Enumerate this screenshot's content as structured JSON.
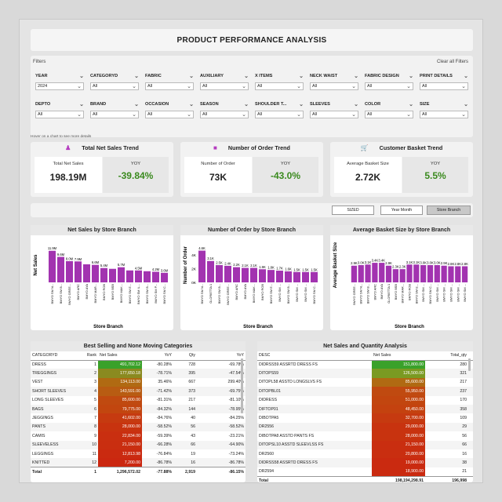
{
  "title": "PRODUCT PERFORMANCE ANALYSIS",
  "filters": {
    "heading": "Filters",
    "clear_label": "Clear all Filters",
    "items": [
      {
        "label": "YEAR",
        "value": "2024"
      },
      {
        "label": "CATEGORYD",
        "value": "All"
      },
      {
        "label": "FABRIC",
        "value": "All"
      },
      {
        "label": "AUXILIARY",
        "value": "All"
      },
      {
        "label": "X ITEMS",
        "value": "All"
      },
      {
        "label": "NECK WAIST",
        "value": "All"
      },
      {
        "label": "FABRIC DESIGN",
        "value": "All"
      },
      {
        "label": "PRINT DETAILS",
        "value": "All"
      },
      {
        "label": "DEPTO",
        "value": "All"
      },
      {
        "label": "BRAND",
        "value": "All"
      },
      {
        "label": "OCCASION",
        "value": "All"
      },
      {
        "label": "SEASON",
        "value": "All"
      },
      {
        "label": "SHOULDER T...",
        "value": "All"
      },
      {
        "label": "SLEEVES",
        "value": "All"
      },
      {
        "label": "COLOR",
        "value": "All"
      },
      {
        "label": "SIZE",
        "value": "All"
      }
    ]
  },
  "hover_hint": "Hover on a chart to see more details",
  "kpis": [
    {
      "title": "Total Net Sales Trend",
      "icon": "person-icon",
      "label": "Total Net Sales",
      "value": "198.19M",
      "yoy_label": "YOY",
      "yoy": "-39.84%"
    },
    {
      "title": "Number of Order Trend",
      "icon": "box-icon",
      "label": "Number of Order",
      "value": "73K",
      "yoy_label": "YOY",
      "yoy": "-43.0%"
    },
    {
      "title": "Customer Basket Trend",
      "icon": "cart-icon",
      "label": "Average Basket Size",
      "value": "2.72K",
      "yoy_label": "YOY",
      "yoy": "5.5%"
    }
  ],
  "toggles": [
    {
      "label": "SIZED",
      "active": false
    },
    {
      "label": "Year Month",
      "active": false
    },
    {
      "label": "Store Branch",
      "active": true
    }
  ],
  "colors": {
    "bar": "#a233b0",
    "line": "#b03cc0",
    "positive": "#3a8a1e"
  },
  "chart_data": [
    {
      "type": "bar",
      "title": "Net Sales by Store Branch",
      "xlabel": "Store Branch",
      "ylabel": "Net Sales",
      "categories": [
        "BMYO SM N...",
        "BMYO SM B...",
        "BMYO GREE...",
        "BMYO ARC",
        "BMYO AYA",
        "BMYO MAR...",
        "BMYO ROB",
        "BMYO BSB",
        "BMYO MAK...",
        "BMYO SM E...",
        "BMYO SM IL...",
        "BMYO SM B...",
        "BMYO SM P...",
        "BMYO SM C..."
      ],
      "values": [
        11.9,
        9.6,
        8.0,
        7.9,
        6.8,
        6.6,
        5.4,
        5.1,
        5.7,
        4.5,
        4.5,
        4.2,
        4.0,
        3.6
      ],
      "data_labels": [
        "11.9M",
        "9.6M",
        "8.0M",
        "7.9M",
        "",
        "6.6M",
        "5.4M",
        "",
        "5.7M",
        "",
        "4.5M",
        "",
        "4.2M",
        "3.6M"
      ],
      "ylim": [
        0,
        13
      ]
    },
    {
      "type": "bar",
      "title": "Number of Order by Store Branch",
      "xlabel": "Store Branch",
      "ylabel": "Number of Order",
      "categories": [
        "BMYO SM N...",
        "GLORIETTA 1",
        "BMYO SM B...",
        "BMYO GREE...",
        "BMYO ARC",
        "BMYO AYA",
        "BMYO MAK...",
        "BMYO ROB",
        "BMYO SM E...",
        "BMYO SM ...",
        "BMYO SM B...",
        "BMYO SM ...",
        "BMYO SM ...",
        "BMYO SM C..."
      ],
      "values": [
        4.6,
        3.1,
        2.5,
        2.4,
        2.2,
        2.1,
        2.1,
        1.9,
        1.8,
        1.7,
        1.6,
        1.5,
        1.5,
        1.5
      ],
      "data_labels": [
        "4.6K",
        "3.1K",
        "2.5K",
        "2.4K",
        "2.2K",
        "2.1K",
        "2.1K",
        "1.9K",
        "1.8K",
        "1.7K",
        "1.6K",
        "1.5K",
        "1.5K",
        "1.5K"
      ],
      "yticks": [
        "0K",
        "2K",
        "4K"
      ],
      "ylim": [
        0,
        5
      ]
    },
    {
      "type": "bar",
      "title": "Average Basket Size by Store Branch",
      "xlabel": "Store Branch",
      "ylabel": "Average Basket Size",
      "categories": [
        "BMYO GREE...",
        "BMYO SM N...",
        "BMYO SM B...",
        "BMYO ARC",
        "BMYO AYA",
        "GLORIETTA 1",
        "BMYO BSB",
        "BMYO MAR...",
        "BMYO ROB",
        "BMYO SM E...",
        "BMYO SM ...",
        "BMYO SM C...",
        "BMYO SM ...",
        "BMYO SM ...",
        "BMYO SM ...",
        "BMYO SM ...",
        "BMYO SM ..."
      ],
      "values": [
        2.9,
        3.0,
        3.1,
        3.4,
        3.4,
        2.9,
        2.3,
        2.3,
        3.1,
        3.1,
        3.0,
        3.0,
        3.0,
        2.9,
        2.8,
        2.8,
        2.8
      ],
      "data_labels": [
        "2.9K",
        "3.0K",
        "3.1K",
        "3.4K",
        "3.4K",
        "2.9K",
        "2.3K",
        "2.3K",
        "3.1K",
        "3.1K",
        "3.0K",
        "3.0K",
        "3.0K",
        "2.9K",
        "2.8K",
        "2.8K",
        "2.8K"
      ],
      "ylim": [
        0,
        6
      ]
    }
  ],
  "best_selling": {
    "title": "Best Selling and None Moving Categories",
    "headers": [
      "CATEGORYD",
      "Rank",
      "Net Sales",
      "YoY",
      "Qty",
      "YoY"
    ],
    "rows": [
      {
        "cat": "DRESS",
        "rank": "1",
        "sales": "491,702.12",
        "yoy": "-80.28%",
        "qty": "728",
        "qyoy": "-69.78%",
        "bg": "#3aa12a"
      },
      {
        "cat": "TREGGINGS",
        "rank": "2",
        "sales": "177,650.18",
        "yoy": "-78.71%",
        "qty": "395",
        "qyoy": "-47.54%",
        "bg": "#8a8a20"
      },
      {
        "cat": "VEST",
        "rank": "3",
        "sales": "134,113.00",
        "yoy": "35.46%",
        "qty": "667",
        "qyoy": "299.40%",
        "bg": "#b06a12"
      },
      {
        "cat": "SHORT SLEEVES",
        "rank": "4",
        "sales": "143,591.00",
        "yoy": "-71.42%",
        "qty": "373",
        "qyoy": "-69.75%",
        "bg": "#b85c12"
      },
      {
        "cat": "LONG SLEEVES",
        "rank": "5",
        "sales": "85,600.00",
        "yoy": "-81.31%",
        "qty": "217",
        "qyoy": "-81.10%",
        "bg": "#c04a10"
      },
      {
        "cat": "BAGS",
        "rank": "6",
        "sales": "79,775.00",
        "yoy": "-84.32%",
        "qty": "144",
        "qyoy": "-78.95%",
        "bg": "#c2460f"
      },
      {
        "cat": "JEGGINGS",
        "rank": "7",
        "sales": "41,602.00",
        "yoy": "-84.76%",
        "qty": "40",
        "qyoy": "-84.25%",
        "bg": "#c63a10"
      },
      {
        "cat": "PANTS",
        "rank": "8",
        "sales": "28,000.00",
        "yoy": "-58.52%",
        "qty": "56",
        "qyoy": "-58.52%",
        "bg": "#c8330f"
      },
      {
        "cat": "CAMIS",
        "rank": "9",
        "sales": "22,834.00",
        "yoy": "-59.39%",
        "qty": "43",
        "qyoy": "-23.21%",
        "bg": "#c92f10"
      },
      {
        "cat": "SLEEVELESS",
        "rank": "10",
        "sales": "21,150.00",
        "yoy": "-66.28%",
        "qty": "66",
        "qyoy": "-64.90%",
        "bg": "#c92e10"
      },
      {
        "cat": "LEGGINGS",
        "rank": "11",
        "sales": "12,813.98",
        "yoy": "-76.84%",
        "qty": "19",
        "qyoy": "-73.24%",
        "bg": "#ca2a10"
      },
      {
        "cat": "KNITTED",
        "rank": "12",
        "sales": "7,200.00",
        "yoy": "-86.78%",
        "qty": "16",
        "qyoy": "-86.78%",
        "bg": "#cb2710"
      }
    ],
    "total": {
      "cat": "Total",
      "rank": "1",
      "sales": "1,296,572.02",
      "yoy": "-77.88%",
      "qty": "2,919",
      "qyoy": "-86.15%"
    }
  },
  "net_qty": {
    "title": "Net Sales and Quantity Analysis",
    "headers": [
      "DESC",
      "Net Sales",
      "Total_qty"
    ],
    "rows": [
      {
        "desc": "DIDRSS59 ASSRTD DRESS FS",
        "sales": "151,800.00",
        "qty": "280",
        "bg": "#3aa12a"
      },
      {
        "desc": "DITOPS59",
        "sales": "126,500.00",
        "qty": "321",
        "bg": "#7a9a22"
      },
      {
        "desc": "DITOPL58 ASSTD LONGSLVS FS",
        "sales": "85,600.00",
        "qty": "217",
        "bg": "#b06a12"
      },
      {
        "desc": "DITOPBL01",
        "sales": "55,950.00",
        "qty": "237",
        "bg": "#c04a10"
      },
      {
        "desc": "DIDRESS",
        "sales": "51,000.00",
        "qty": "170",
        "bg": "#c2460f"
      },
      {
        "desc": "DIFTOP01",
        "sales": "48,450.00",
        "qty": "358",
        "bg": "#c4420f"
      },
      {
        "desc": "DIBOTPA5",
        "sales": "32,700.00",
        "qty": "109",
        "bg": "#c63a10"
      },
      {
        "desc": "DR2556",
        "sales": "29,000.00",
        "qty": "29",
        "bg": "#c8330f"
      },
      {
        "desc": "DIBOTPA8 ASSTD PANTS FS",
        "sales": "28,000.00",
        "qty": "56",
        "bg": "#c8330f"
      },
      {
        "desc": "DITOPSL10 ASSTD SLEEVLSS FS",
        "sales": "21,150.00",
        "qty": "66",
        "bg": "#c92e10"
      },
      {
        "desc": "DR2560",
        "sales": "20,800.00",
        "qty": "16",
        "bg": "#c92e10"
      },
      {
        "desc": "DIDRSS58 ASSRTD DRESS FS",
        "sales": "19,000.00",
        "qty": "38",
        "bg": "#ca2a10"
      },
      {
        "desc": "DR2594",
        "sales": "18,900.00",
        "qty": "21",
        "bg": "#ca2a10"
      }
    ],
    "total": {
      "desc": "Total",
      "sales": "198,194,298.91",
      "qty": "196,998"
    }
  }
}
